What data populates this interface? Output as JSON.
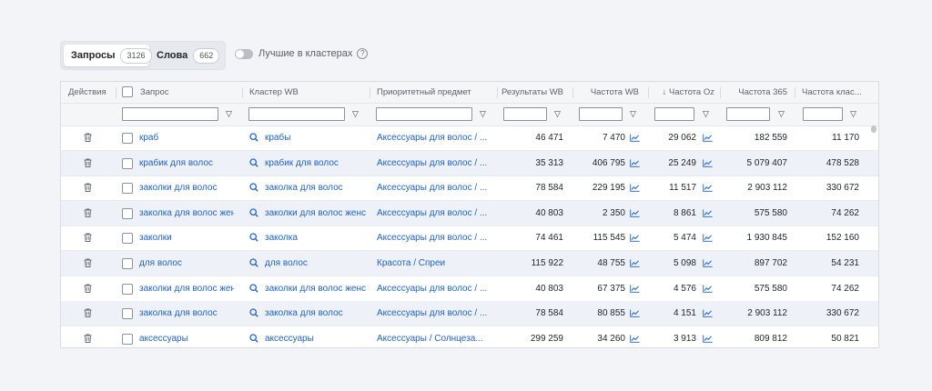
{
  "tabs": [
    {
      "label": "Запросы",
      "count": "3126"
    },
    {
      "label": "Слова",
      "count": "662"
    }
  ],
  "toggle": {
    "label": "Лучшие в кластерах",
    "help": "?"
  },
  "columns": {
    "actions": "Действия",
    "query": "Запрос",
    "cluster": "Кластер WB",
    "subject": "Приоритетный предмет",
    "results": "Результаты WB",
    "freq_wb": "Частота WB",
    "freq_oz": "Частота Oz",
    "freq_365": "Частота 365",
    "freq_cluster": "Частота клас..."
  },
  "sort_indicator": "↓",
  "filter_icon": "▽",
  "rows": [
    {
      "query": "краб",
      "cluster": "крабы",
      "subject": "Аксессуары для волос / ...",
      "results": "46 471",
      "freq_wb": "7 470",
      "freq_oz": "29 062",
      "freq_365": "182 559",
      "freq_cluster": "11 170"
    },
    {
      "query": "крабик для волос",
      "cluster": "крабик для волос",
      "subject": "Аксессуары для волос / ...",
      "results": "35 313",
      "freq_wb": "406 795",
      "freq_oz": "25 249",
      "freq_365": "5 079 407",
      "freq_cluster": "478 528"
    },
    {
      "query": "заколки для волос",
      "cluster": "заколка для волос",
      "subject": "Аксессуары для волос / ...",
      "results": "78 584",
      "freq_wb": "229 195",
      "freq_oz": "11 517",
      "freq_365": "2 903 112",
      "freq_cluster": "330 672"
    },
    {
      "query": "заколка для волос жен",
      "cluster": "заколки для волос женс",
      "subject": "Аксессуары для волос / ...",
      "results": "40 803",
      "freq_wb": "2 350",
      "freq_oz": "8 861",
      "freq_365": "575 580",
      "freq_cluster": "74 262"
    },
    {
      "query": "заколки",
      "cluster": "заколка",
      "subject": "Аксессуары для волос / ...",
      "results": "74 461",
      "freq_wb": "115 545",
      "freq_oz": "5 474",
      "freq_365": "1 930 845",
      "freq_cluster": "152 160"
    },
    {
      "query": "для волос",
      "cluster": "для волос",
      "subject": "Красота / Спреи",
      "results": "115 922",
      "freq_wb": "48 755",
      "freq_oz": "5 098",
      "freq_365": "897 702",
      "freq_cluster": "54 231"
    },
    {
      "query": "заколки для волос жен",
      "cluster": "заколки для волос женс",
      "subject": "Аксессуары для волос / ...",
      "results": "40 803",
      "freq_wb": "67 375",
      "freq_oz": "4 576",
      "freq_365": "575 580",
      "freq_cluster": "74 262"
    },
    {
      "query": "заколка для волос",
      "cluster": "заколка для волос",
      "subject": "Аксессуары для волос / ...",
      "results": "78 584",
      "freq_wb": "80 855",
      "freq_oz": "4 151",
      "freq_365": "2 903 112",
      "freq_cluster": "330 672"
    },
    {
      "query": "аксессуары",
      "cluster": "аксессуары",
      "subject": "Аксессуары / Солнцеза...",
      "results": "299 259",
      "freq_wb": "34 260",
      "freq_oz": "3 913",
      "freq_365": "809 812",
      "freq_cluster": "50 821"
    }
  ]
}
